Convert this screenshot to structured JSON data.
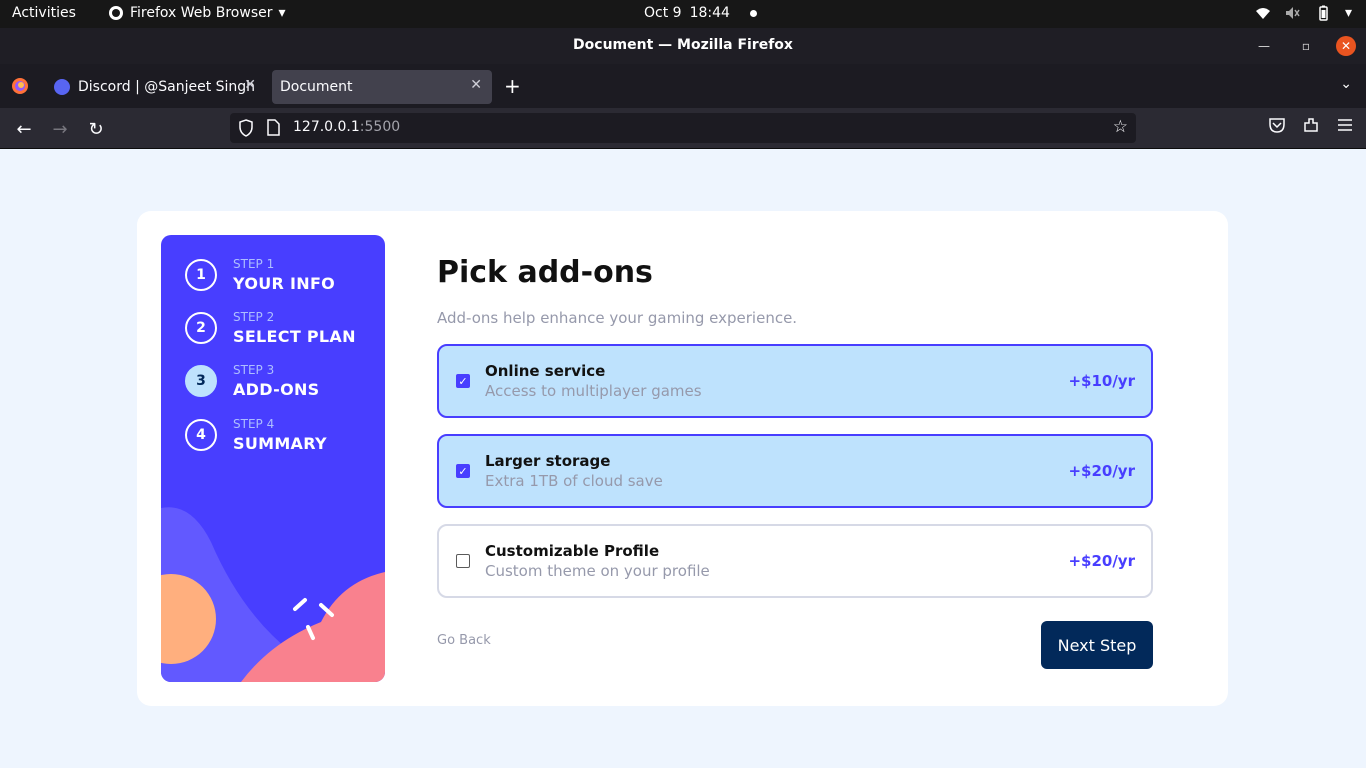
{
  "system": {
    "activities": "Activities",
    "app_menu": "Firefox Web Browser",
    "date": "Oct 9",
    "time": "18:44"
  },
  "window": {
    "title": "Document — Mozilla Firefox"
  },
  "tabs": [
    {
      "label": "Discord | @Sanjeet Singh",
      "active": false
    },
    {
      "label": "Document",
      "active": true
    }
  ],
  "urlbar": {
    "host": "127.0.0.1",
    "port": ":5500"
  },
  "steps": [
    {
      "number": "1",
      "label": "STEP 1",
      "name": "YOUR INFO",
      "active": false
    },
    {
      "number": "2",
      "label": "STEP 2",
      "name": "SELECT PLAN",
      "active": false
    },
    {
      "number": "3",
      "label": "STEP 3",
      "name": "ADD-ONS",
      "active": true
    },
    {
      "number": "4",
      "label": "STEP 4",
      "name": "SUMMARY",
      "active": false
    }
  ],
  "page": {
    "heading": "Pick add-ons",
    "subheading": "Add-ons help enhance your gaming experience.",
    "addons": [
      {
        "name": "Online service",
        "desc": "Access to multiplayer games",
        "price": "+$10/yr",
        "checked": true
      },
      {
        "name": "Larger storage",
        "desc": "Extra 1TB of cloud save",
        "price": "+$20/yr",
        "checked": true
      },
      {
        "name": "Customizable Profile",
        "desc": "Custom theme on your profile",
        "price": "+$20/yr",
        "checked": false
      }
    ],
    "go_back": "Go Back",
    "next_step": "Next Step"
  },
  "colors": {
    "accent": "#483eff",
    "selected_bg": "#bee2fd",
    "dark_blue": "#02295a",
    "page_bg": "#eef5fe"
  }
}
